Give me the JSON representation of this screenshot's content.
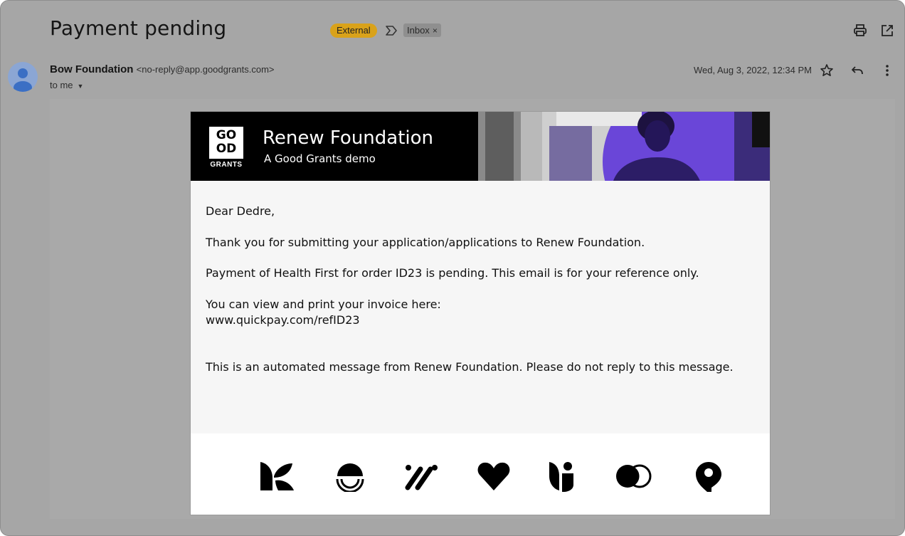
{
  "email": {
    "subject": "Payment pending",
    "labels": {
      "external": "External",
      "inbox": "Inbox",
      "inbox_remove": "×"
    },
    "sender_name": "Bow Foundation",
    "sender_email": "<no-reply@app.goodgrants.com>",
    "to": "to me",
    "date": "Wed, Aug 3, 2022, 12:34 PM"
  },
  "banner": {
    "logo_line1": "GO",
    "logo_line2": "OD",
    "logo_line3": "GRANTS",
    "title": "Renew Foundation",
    "subtitle": "A Good Grants demo"
  },
  "message": {
    "greeting": "Dear Dedre,",
    "line1": "Thank you for submitting your application/applications to Renew Foundation.",
    "line2": "Payment of Health First for order ID23 is pending. This email is for your reference only.",
    "line3": "You can view and print your invoice here:",
    "link": "www.quickpay.com/refID23",
    "line4": "This is an automated message from Renew Foundation. Please do not reply to this message."
  },
  "footer_icons": [
    "leaf-logo-icon",
    "half-circle-logo-icon",
    "slash-marks-logo-icon",
    "heart-logo-icon",
    "sprout-logo-icon",
    "overlap-circles-logo-icon",
    "pin-logo-icon"
  ],
  "colors": {
    "external_label": "#d9a21a",
    "banner_bg": "#000000",
    "photo_accent": "#6a46d8"
  }
}
